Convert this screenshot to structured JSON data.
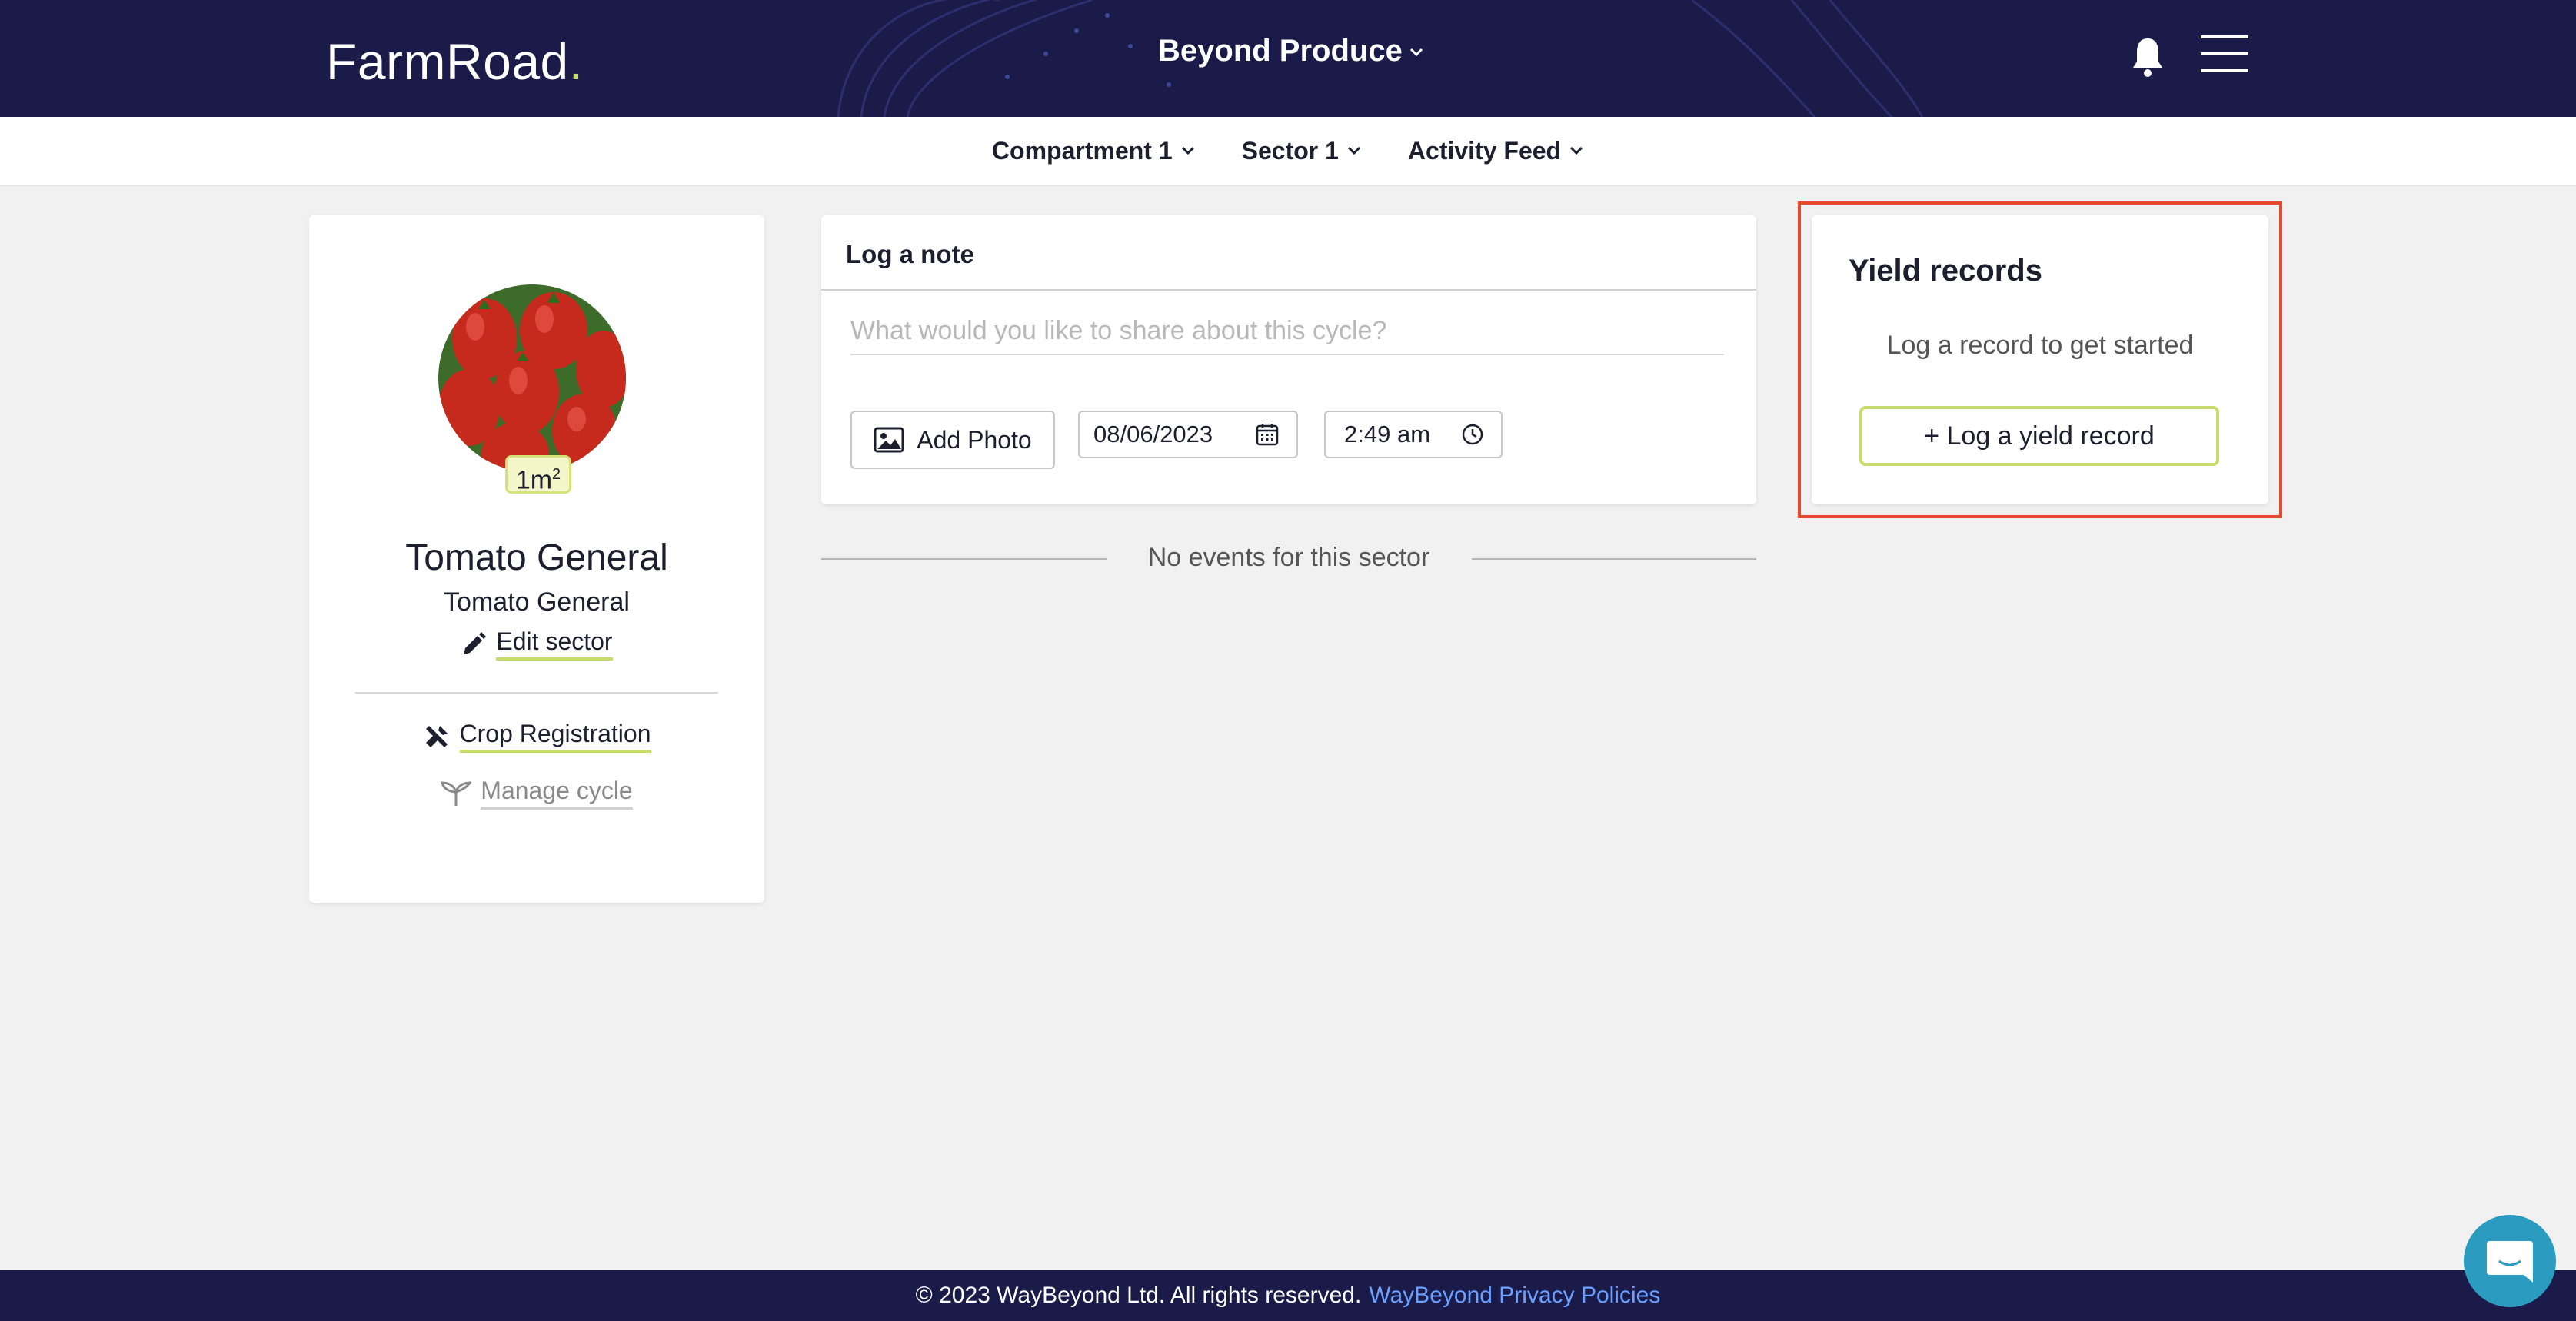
{
  "header": {
    "logo": "FarmRoad",
    "logo_dot": ".",
    "org_name": "Beyond Produce"
  },
  "subnav": {
    "compartment": "Compartment 1",
    "sector": "Sector 1",
    "activity": "Activity Feed"
  },
  "sector_card": {
    "area_value": "1m",
    "area_unit_sup": "2",
    "title": "Tomato General",
    "subtitle": "Tomato General",
    "edit_label": "Edit sector",
    "crop_registration_label": "Crop Registration",
    "manage_cycle_label": "Manage cycle"
  },
  "note": {
    "header": "Log a note",
    "placeholder": "What would you like to share about this cycle?",
    "add_photo_label": "Add Photo",
    "date": "08/06/2023",
    "time": "2:49 am"
  },
  "events": {
    "empty_message": "No events for this sector"
  },
  "yield": {
    "title": "Yield records",
    "empty_message": "Log a record to get started",
    "button_label": "+ Log a yield record"
  },
  "footer": {
    "copyright": "© 2023 WayBeyond Ltd. All rights reserved.",
    "policy_link": "WayBeyond Privacy Policies"
  },
  "colors": {
    "navy": "#1b1b4a",
    "accent_green": "#c8dc6b",
    "highlight_red": "#e64a2e",
    "link_blue": "#6aa0ff",
    "chat_teal": "#2b9bbf"
  }
}
